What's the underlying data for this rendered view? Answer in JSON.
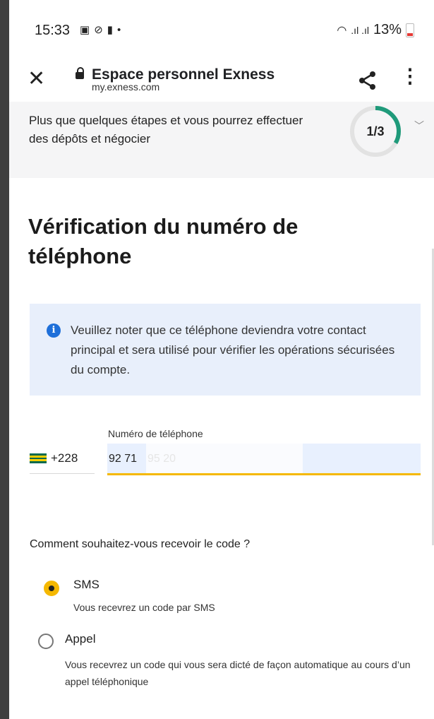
{
  "status_bar": {
    "time": "15:33",
    "left_icons": [
      "photo-icon",
      "circle-play-icon",
      "battery-saver-icon",
      "dot-icon"
    ],
    "battery": "13%"
  },
  "url_bar": {
    "title": "Espace personnel Exness",
    "domain": "my.exness.com"
  },
  "progress_banner": {
    "message": "Plus que quelques étapes et vous pourrez effectuer des dépôts et négocier",
    "step": "1/3",
    "fraction": 0.333,
    "accent": "#1f9a7a"
  },
  "page": {
    "title": "Vérification du numéro de téléphone"
  },
  "info_box": {
    "text": "Veuillez noter que ce téléphone deviendra votre contact principal et sera utilisé pour vérifier les opérations sécurisées du compte."
  },
  "phone_field": {
    "label": "Numéro de téléphone",
    "country_code": "+228",
    "value_visible": "92 71",
    "value_obscured": "95 20",
    "underline_color": "#f5b800"
  },
  "delivery": {
    "question": "Comment souhaitez-vous recevoir le code ?",
    "options": [
      {
        "label": "SMS",
        "description": "Vous recevrez un code par SMS",
        "selected": true
      },
      {
        "label": "Appel",
        "description": "Vous recevrez un code qui vous sera dicté de façon automatique au cours d’un appel téléphonique",
        "selected": false
      }
    ]
  }
}
